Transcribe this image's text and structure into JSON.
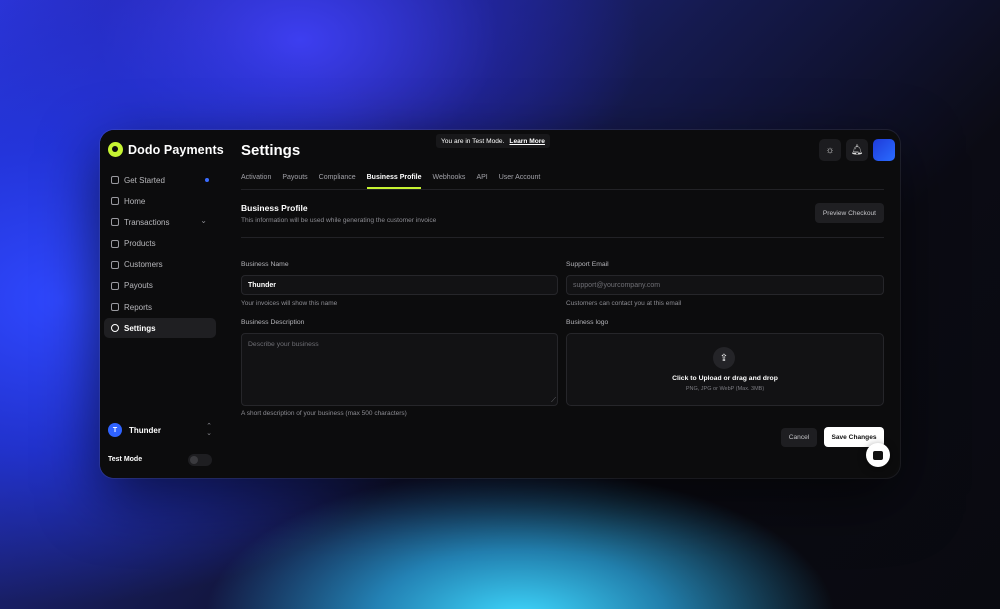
{
  "brand": {
    "name": "Dodo Payments"
  },
  "sidebar": {
    "items": [
      {
        "label": "Get Started",
        "icon": "rocket-icon"
      },
      {
        "label": "Home",
        "icon": "home-icon"
      },
      {
        "label": "Transactions",
        "icon": "transactions-icon"
      },
      {
        "label": "Products",
        "icon": "box-icon"
      },
      {
        "label": "Customers",
        "icon": "users-icon"
      },
      {
        "label": "Payouts",
        "icon": "wallet-icon"
      },
      {
        "label": "Reports",
        "icon": "report-icon"
      },
      {
        "label": "Settings",
        "icon": "gear-icon",
        "active": true
      }
    ],
    "account": {
      "initial": "T",
      "name": "Thunder"
    },
    "test_mode_label": "Test Mode",
    "test_mode_on": false
  },
  "banner": {
    "text": "You are in Test Mode.",
    "link": "Learn More"
  },
  "page": {
    "title": "Settings"
  },
  "tabs": [
    "Activation",
    "Payouts",
    "Compliance",
    "Business Profile",
    "Webhooks",
    "API",
    "User Account"
  ],
  "active_tab": "Business Profile",
  "section": {
    "title": "Business Profile",
    "subtitle": "This information will be used while generating the customer invoice",
    "preview_button": "Preview Checkout"
  },
  "form": {
    "business_name": {
      "label": "Business Name",
      "value": "Thunder",
      "hint": "Your invoices will show this name"
    },
    "support_email": {
      "label": "Support Email",
      "placeholder": "support@yourcompany.com",
      "hint": "Customers can contact you at this email"
    },
    "business_description": {
      "label": "Business Description",
      "placeholder": "Describe your business",
      "hint": "A short description of your business (max 500 characters)"
    },
    "business_logo": {
      "label": "Business logo",
      "title": "Click to Upload or drag and drop",
      "subtitle": "PNG, JPG or WebP (Max. 3MB)"
    }
  },
  "actions": {
    "cancel": "Cancel",
    "save": "Save Changes"
  },
  "colors": {
    "accent": "#c6f432",
    "background": "#0c0c0d",
    "avatar": "#2f63ff"
  }
}
